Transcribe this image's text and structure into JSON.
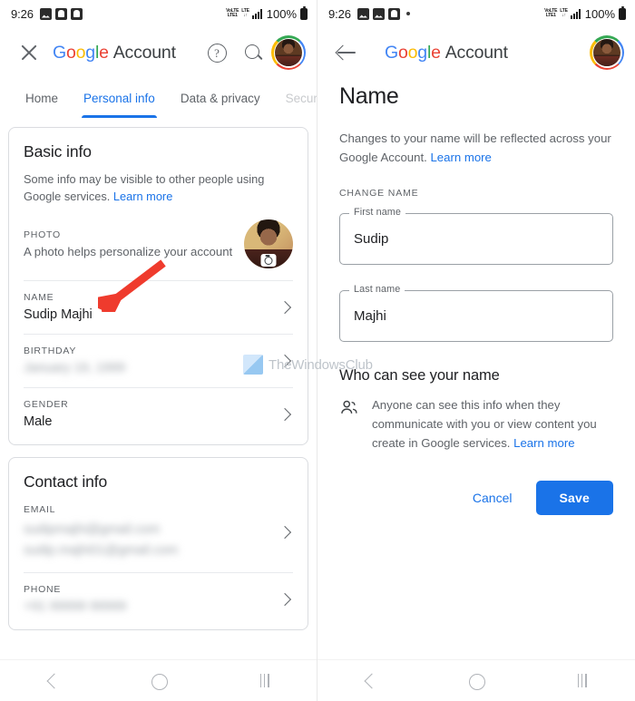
{
  "status_bar": {
    "time": "9:26",
    "network_label_top": "VoLTE",
    "network_label_bottom": "LTE1",
    "network_label2_top": "LTE",
    "battery_percent": "100%"
  },
  "left_screen": {
    "appbar": {
      "close_label": "Close",
      "brand_g": "G",
      "brand_o1": "o",
      "brand_o2": "o",
      "brand_g2": "g",
      "brand_l": "l",
      "brand_e": "e",
      "brand_account": "Account",
      "help_label": "?",
      "search_label": "Search",
      "avatar_label": "Google Account profile photo"
    },
    "tabs": [
      {
        "label": "Home",
        "active": false,
        "faded": false
      },
      {
        "label": "Personal info",
        "active": true,
        "faded": false
      },
      {
        "label": "Data & privacy",
        "active": false,
        "faded": false
      },
      {
        "label": "Securi",
        "active": false,
        "faded": true
      }
    ],
    "basic_info": {
      "title": "Basic info",
      "subtitle": "Some info may be visible to other people using Google services.",
      "subtitle_link": "Learn more",
      "rows": [
        {
          "label": "PHOTO",
          "value": "A photo helps personalize your account",
          "kind": "photo"
        },
        {
          "label": "NAME",
          "value": "Sudip Majhi",
          "kind": "text"
        },
        {
          "label": "BIRTHDAY",
          "value": "January 19, 1999",
          "kind": "blurred"
        },
        {
          "label": "GENDER",
          "value": "Male",
          "kind": "text"
        }
      ]
    },
    "contact_info": {
      "title": "Contact info",
      "rows": [
        {
          "label": "EMAIL",
          "value": "sudipmajhi@gmail.com",
          "value2": "sudip.majhi01@gmail.com",
          "kind": "blurred"
        },
        {
          "label": "PHONE",
          "value": "+91 99999 99999",
          "kind": "blurred"
        }
      ]
    }
  },
  "right_screen": {
    "appbar": {
      "back_label": "Back",
      "brand_account": "Account",
      "avatar_label": "Google Account profile photo"
    },
    "page_title": "Name",
    "description": "Changes to your name will be reflected across your Google Account.",
    "description_link": "Learn more",
    "section_label": "CHANGE NAME",
    "fields": [
      {
        "legend": "First name",
        "value": "Sudip"
      },
      {
        "legend": "Last name",
        "value": "Majhi"
      }
    ],
    "visibility": {
      "title": "Who can see your name",
      "text": "Anyone can see this info when they communicate with you or view content you create in Google services.",
      "link": "Learn more",
      "icon": "people-icon"
    },
    "buttons": {
      "cancel": "Cancel",
      "save": "Save"
    }
  },
  "watermark": {
    "text": "TheWindowsClub"
  },
  "nav_bar": {
    "back": "Back",
    "home": "Home",
    "recents": "Recents"
  },
  "colors": {
    "accent_blue": "#1a73e8",
    "google_blue": "#4285F4",
    "google_red": "#EA4335",
    "google_yellow": "#FBBC05",
    "google_green": "#34A853",
    "arrow_red": "#ef3b2d",
    "text_primary": "#202124",
    "text_secondary": "#5f6368",
    "card_border": "#dadce0"
  }
}
